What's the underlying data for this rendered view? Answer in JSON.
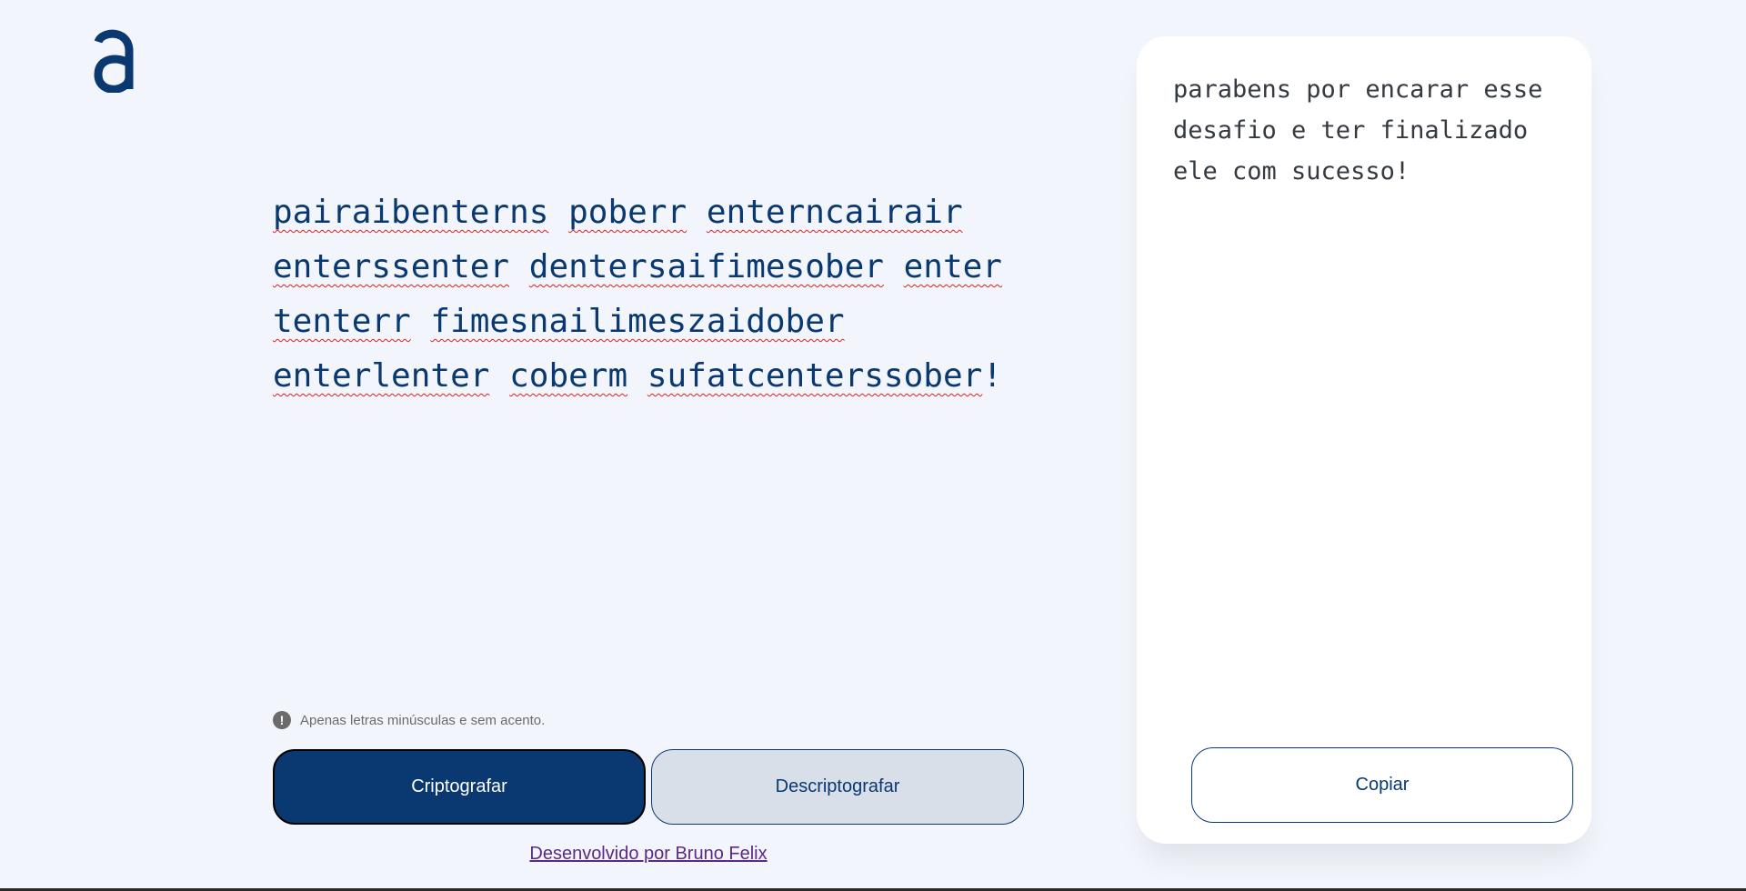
{
  "header": {
    "logo_icon": "alura-a-logo-icon"
  },
  "editor": {
    "input_text": "pairaibenterns poberr enterncairair enterssenter dentersaifimesober enter tenterr fimesnailimeszaidober enterlenter coberm sufatcenterssober!",
    "hint_icon": "exclamation-circle-icon",
    "hint_icon_glyph": "!",
    "hint_text": "Apenas letras minúsculas e sem acento.",
    "encrypt_label": "Criptografar",
    "decrypt_label": "Descriptografar"
  },
  "output": {
    "text": "parabens por encarar esse desafio e ter finalizado ele com sucesso!",
    "copy_label": "Copiar"
  },
  "footer": {
    "credit_link": "Desenvolvido por Bruno Felix"
  },
  "colors": {
    "background": "#f3f5fc",
    "primary": "#0a3871",
    "secondary_button": "#d8dfe8",
    "spellcheck_underline": "#e0211f",
    "link": "#5b2a86"
  }
}
